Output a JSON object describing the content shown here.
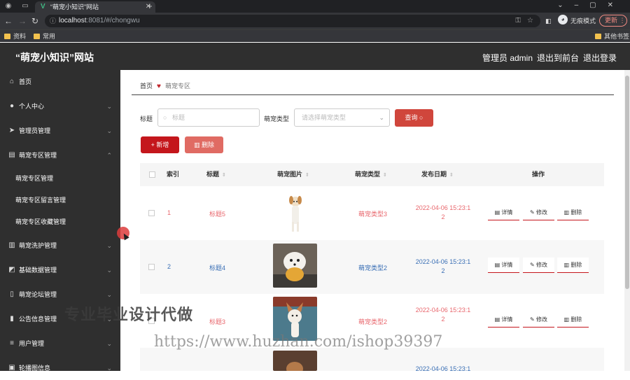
{
  "browser": {
    "tab_title": "“萌宠小知识”网站",
    "url_host": "localhost",
    "url_path": ":8081/#/chongwu",
    "incognito_label": "无痕模式",
    "update_label": "更新",
    "bookmarks": [
      "资料",
      "常用"
    ],
    "other_bookmarks": "其他书签"
  },
  "header": {
    "site_title": "“萌宠小知识”网站",
    "admin_label": "管理员 admin",
    "back_front": "退出到前台",
    "logout": "退出登录"
  },
  "sidebar": {
    "items": [
      {
        "label": "首页",
        "icon": "home-icon"
      },
      {
        "label": "个人中心",
        "icon": "user-icon"
      },
      {
        "label": "管理员管理",
        "icon": "send-icon"
      },
      {
        "label": "萌宠专区管理",
        "icon": "list-icon"
      },
      {
        "label": "萌宠洗护管理",
        "icon": "chart-icon"
      },
      {
        "label": "基础数据管理",
        "icon": "data-icon"
      },
      {
        "label": "萌宠论坛管理",
        "icon": "forum-icon"
      },
      {
        "label": "公告信息管理",
        "icon": "bar-icon"
      },
      {
        "label": "用户管理",
        "icon": "menu-icon"
      },
      {
        "label": "轮播图信息",
        "icon": "image-icon"
      }
    ],
    "sub_items": [
      "萌宠专区管理",
      "萌宠专区留言管理",
      "萌宠专区收藏管理"
    ]
  },
  "breadcrumb": {
    "home": "首页",
    "current": "萌宠专区"
  },
  "search": {
    "title_label": "标题",
    "title_placeholder": "标题",
    "type_label": "萌宠类型",
    "type_placeholder": "请选择萌宠类型",
    "query_button": "查询"
  },
  "actions": {
    "add": "新增",
    "delete": "删除"
  },
  "table": {
    "columns": [
      "索引",
      "标题",
      "萌宠图片",
      "萌宠类型",
      "发布日期",
      "操作"
    ],
    "row_actions": [
      "详情",
      "修改",
      "删除"
    ],
    "rows": [
      {
        "index": "1",
        "title": "标题5",
        "type": "萌宠类型3",
        "date_a": "2022-04-06 15:23:1",
        "date_b": "2"
      },
      {
        "index": "2",
        "title": "标题4",
        "type": "萌宠类型2",
        "date_a": "2022-04-06 15:23:1",
        "date_b": "2"
      },
      {
        "index": "",
        "title": "标题3",
        "type": "萌宠类型2",
        "date_a": "2022-04-06 15:23:1",
        "date_b": "2"
      },
      {
        "index": "",
        "title": "",
        "type": "",
        "date_a": "2022-04-06 15:23:1",
        "date_b": ""
      }
    ]
  },
  "watermark": {
    "line1": "专业毕业设计代做",
    "line2": "https://www.huzhan.com/ishop39397"
  },
  "colors": {
    "accent": "#c4161c",
    "link_red": "#e8676d",
    "link_blue": "#3a6fb5",
    "sidebar_bg": "#2f2f2f"
  }
}
